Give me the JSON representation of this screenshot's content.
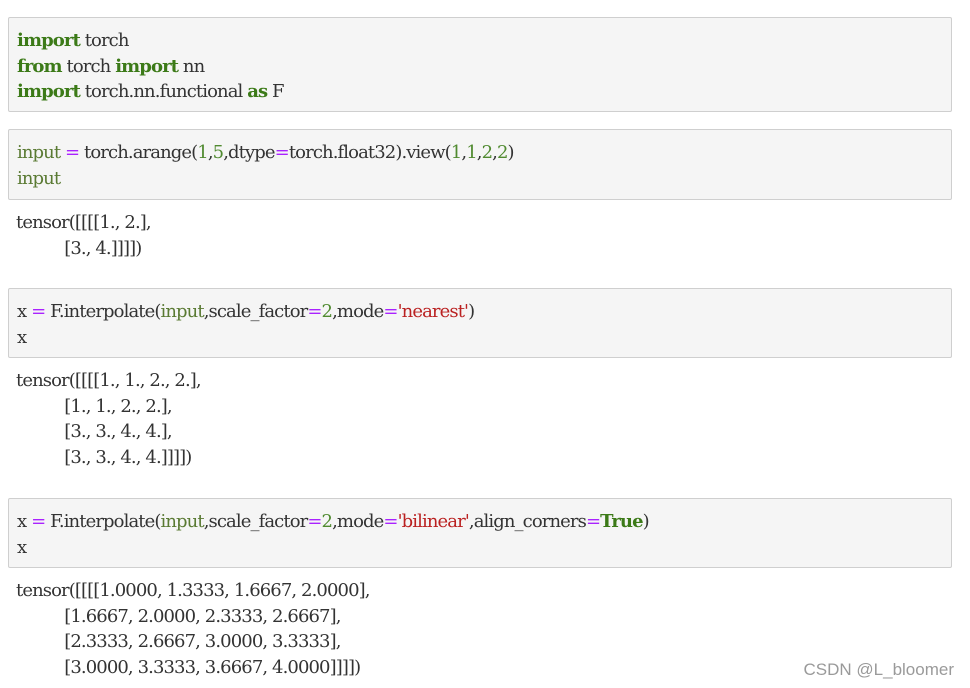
{
  "cells": [
    {
      "input_lines": [
        [
          {
            "t": "import",
            "c": "kw"
          },
          {
            "t": " torch",
            "c": ""
          }
        ],
        [
          {
            "t": "from",
            "c": "kw"
          },
          {
            "t": " torch ",
            "c": ""
          },
          {
            "t": "import",
            "c": "kw"
          },
          {
            "t": " nn",
            "c": ""
          }
        ],
        [
          {
            "t": "import",
            "c": "kw"
          },
          {
            "t": " torch.nn.functional ",
            "c": ""
          },
          {
            "t": "as",
            "c": "kw"
          },
          {
            "t": " F",
            "c": ""
          }
        ]
      ],
      "output_lines": []
    },
    {
      "input_lines": [
        [
          {
            "t": "input",
            "c": "var"
          },
          {
            "t": " ",
            "c": ""
          },
          {
            "t": "=",
            "c": "op"
          },
          {
            "t": " torch.arange(",
            "c": ""
          },
          {
            "t": "1",
            "c": "num"
          },
          {
            "t": ",",
            "c": ""
          },
          {
            "t": "5",
            "c": "num"
          },
          {
            "t": ",dtype",
            "c": ""
          },
          {
            "t": "=",
            "c": "op"
          },
          {
            "t": "torch.float32).view(",
            "c": ""
          },
          {
            "t": "1",
            "c": "num"
          },
          {
            "t": ",",
            "c": ""
          },
          {
            "t": "1",
            "c": "num"
          },
          {
            "t": ",",
            "c": ""
          },
          {
            "t": "2",
            "c": "num"
          },
          {
            "t": ",",
            "c": ""
          },
          {
            "t": "2",
            "c": "num"
          },
          {
            "t": ")",
            "c": ""
          }
        ],
        [
          {
            "t": "input",
            "c": "var"
          }
        ]
      ],
      "output_lines": [
        "tensor([[[[1., 2.],",
        "          [3., 4.]]]])"
      ]
    },
    {
      "input_lines": [
        [
          {
            "t": "x ",
            "c": ""
          },
          {
            "t": "=",
            "c": "op"
          },
          {
            "t": " F.interpolate(",
            "c": ""
          },
          {
            "t": "input",
            "c": "var"
          },
          {
            "t": ",scale_factor",
            "c": ""
          },
          {
            "t": "=",
            "c": "op"
          },
          {
            "t": "2",
            "c": "num"
          },
          {
            "t": ",mode",
            "c": ""
          },
          {
            "t": "=",
            "c": "op"
          },
          {
            "t": "'nearest'",
            "c": "str"
          },
          {
            "t": ")",
            "c": ""
          }
        ],
        [
          {
            "t": "x",
            "c": ""
          }
        ]
      ],
      "output_lines": [
        "tensor([[[[1., 1., 2., 2.],",
        "          [1., 1., 2., 2.],",
        "          [3., 3., 4., 4.],",
        "          [3., 3., 4., 4.]]]])"
      ]
    },
    {
      "input_lines": [
        [
          {
            "t": "x ",
            "c": ""
          },
          {
            "t": "=",
            "c": "op"
          },
          {
            "t": " F.interpolate(",
            "c": ""
          },
          {
            "t": "input",
            "c": "var"
          },
          {
            "t": ",scale_factor",
            "c": ""
          },
          {
            "t": "=",
            "c": "op"
          },
          {
            "t": "2",
            "c": "num"
          },
          {
            "t": ",mode",
            "c": ""
          },
          {
            "t": "=",
            "c": "op"
          },
          {
            "t": "'bilinear'",
            "c": "str"
          },
          {
            "t": ",align_corners",
            "c": ""
          },
          {
            "t": "=",
            "c": "op"
          },
          {
            "t": "True",
            "c": "kw2"
          },
          {
            "t": ")",
            "c": ""
          }
        ],
        [
          {
            "t": "x",
            "c": ""
          }
        ]
      ],
      "output_lines": [
        "tensor([[[[1.0000, 1.3333, 1.6667, 2.0000],",
        "          [1.6667, 2.0000, 2.3333, 2.6667],",
        "          [2.3333, 2.6667, 3.0000, 3.3333],",
        "          [3.0000, 3.3333, 3.6667, 4.0000]]]])"
      ]
    }
  ],
  "watermark": "CSDN @L_bloomer"
}
